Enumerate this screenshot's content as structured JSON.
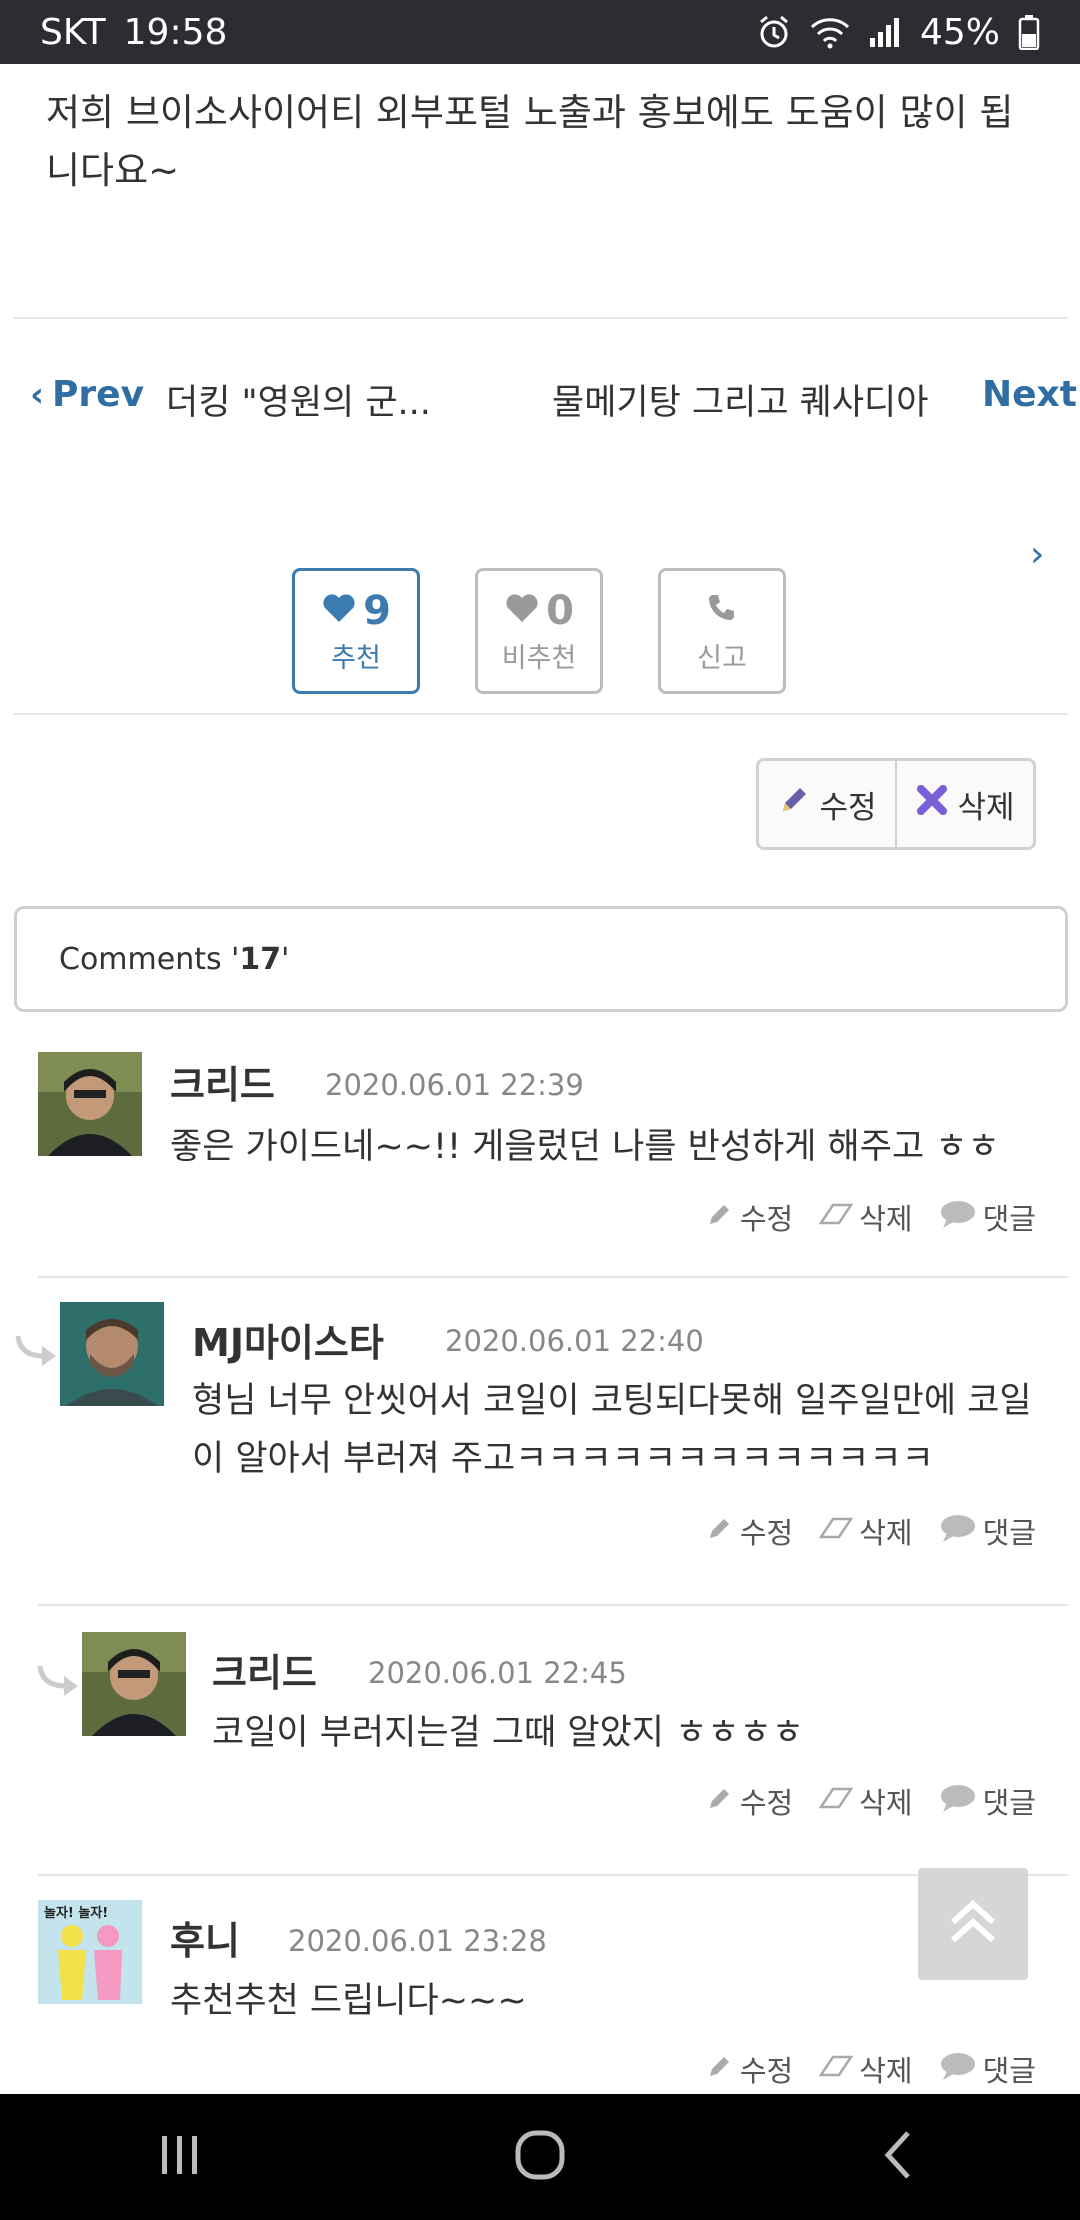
{
  "status_bar": {
    "carrier": "SKT",
    "time": "19:58",
    "battery": "45%"
  },
  "article": {
    "text": "저희 브이소사이어티 외부포털 노출과 홍보에도 도움이 많이 됩니다요~"
  },
  "post_nav": {
    "prev_label": "Prev",
    "prev_title": "더킹 \"영원의 군...",
    "next_title": "물메기탕 그리고 퀘사디아",
    "next_label": "Next"
  },
  "votes": {
    "recommend": {
      "count": "9",
      "label": "추천"
    },
    "not_recommend": {
      "count": "0",
      "label": "비추천"
    },
    "report": {
      "label": "신고"
    }
  },
  "post_actions": {
    "edit": "수정",
    "delete": "삭제"
  },
  "comments_header": {
    "prefix": "Comments '",
    "count": "17",
    "suffix": "'"
  },
  "comment_actions": {
    "edit": "수정",
    "delete": "삭제",
    "reply": "댓글"
  },
  "comments": [
    {
      "name": "크리드",
      "date": "2020.06.01 22:39",
      "text": "좋은 가이드네~~!! 게을렀던 나를 반성하게 해주고 ㅎㅎ"
    },
    {
      "name": "MJ마이스타",
      "date": "2020.06.01 22:40",
      "text": "형님 너무 안씻어서 코일이 코팅되다못해 일주일만에 코일이 알아서 부러져 주고ㅋㅋㅋㅋㅋㅋㅋㅋㅋㅋㅋㅋㅋ"
    },
    {
      "name": "크리드",
      "date": "2020.06.01 22:45",
      "text": "코일이 부러지는걸 그때 알았지 ㅎㅎㅎㅎ"
    },
    {
      "name": "후니",
      "date": "2020.06.01 23:28",
      "text": "추천추천 드립니다~~~",
      "avatar_text": "놀자! 놀자!"
    }
  ],
  "colors": {
    "accent": "#3c7bb0",
    "statusbar": "#2b2d33",
    "navbar": "#000000"
  }
}
